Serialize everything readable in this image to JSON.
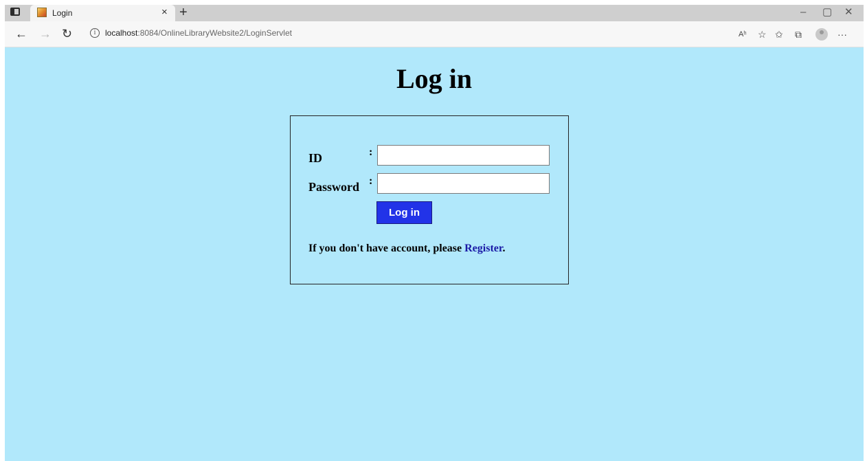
{
  "browser": {
    "tab_title": "Login",
    "tab_close": "×",
    "new_tab": "+",
    "url_host": "localhost",
    "url_path": ":8084/OnlineLibraryWebsite2/LoginServlet",
    "window_controls": {
      "minimize": "–",
      "maximize": "▢",
      "close": "✕"
    },
    "nav": {
      "back": "←",
      "forward": "→",
      "refresh": "↻"
    },
    "toolbar": {
      "read_aloud": "Aʰ",
      "favorites_add": "☆",
      "favorites": "✩",
      "collections": "⧉",
      "more": "···"
    },
    "icons": [
      "tab-actions-icon",
      "favicon",
      "info-icon",
      "read-aloud-icon",
      "add-favorite-icon",
      "favorites-icon",
      "collections-icon",
      "profile-icon",
      "more-icon"
    ]
  },
  "page": {
    "heading": "Log in",
    "id_label": "ID",
    "password_label": "Password",
    "colon": ":",
    "id_value": "",
    "password_value": "",
    "login_button": "Log in",
    "note_prefix": "If you don't have account, please ",
    "register_link": "Register",
    "note_suffix": "."
  },
  "colors": {
    "page_background": "#b1e8fb",
    "button_background": "#2233e8",
    "link": "#1a1aa6"
  }
}
